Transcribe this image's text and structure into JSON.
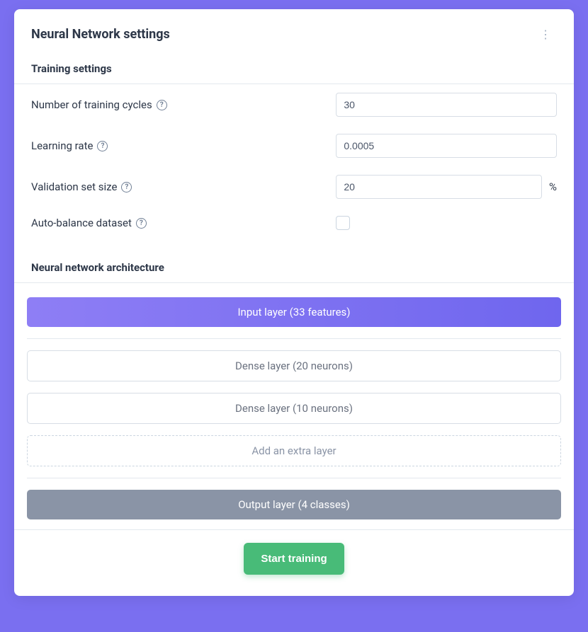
{
  "header": {
    "title": "Neural Network settings"
  },
  "training": {
    "section_title": "Training settings",
    "cycles_label": "Number of training cycles",
    "cycles_value": "30",
    "lr_label": "Learning rate",
    "lr_value": "0.0005",
    "val_label": "Validation set size",
    "val_value": "20",
    "val_suffix": "%",
    "balance_label": "Auto-balance dataset",
    "balance_checked": false
  },
  "arch": {
    "section_title": "Neural network architecture",
    "input_layer": "Input layer (33 features)",
    "dense1": "Dense layer (20 neurons)",
    "dense2": "Dense layer (10 neurons)",
    "add_layer": "Add an extra layer",
    "output_layer": "Output layer (4 classes)"
  },
  "footer": {
    "start_label": "Start training"
  }
}
